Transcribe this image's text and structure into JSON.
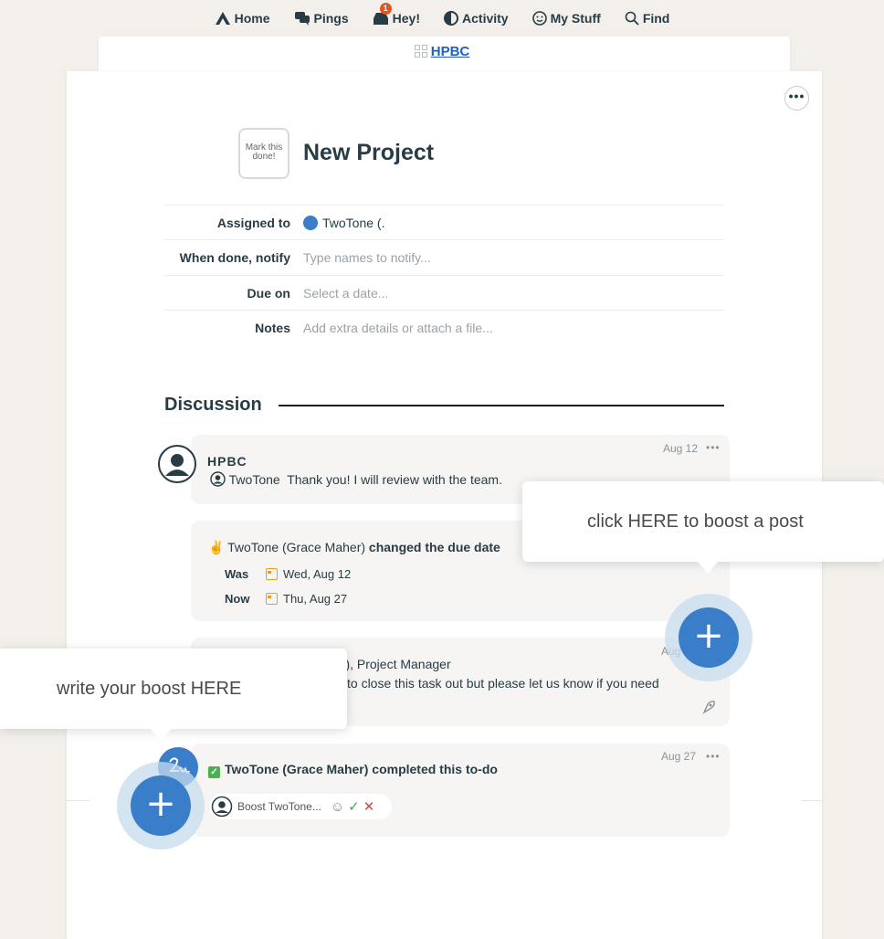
{
  "nav": {
    "home": "Home",
    "pings": "Pings",
    "hey": "Hey!",
    "hey_badge": "1",
    "activity": "Activity",
    "mystuff": "My Stuff",
    "find": "Find"
  },
  "breadcrumb": {
    "project": "HPBC"
  },
  "todo": {
    "checkbox_label": "Mark this done!",
    "title": "New Project",
    "fields": {
      "assigned_label": "Assigned to",
      "assigned_value": "TwoTone (.",
      "notify_label": "When done, notify",
      "notify_placeholder": "Type names to notify...",
      "due_label": "Due on",
      "due_placeholder": "Select a date...",
      "notes_label": "Notes",
      "notes_placeholder": "Add extra details or attach a file..."
    }
  },
  "discussion": {
    "title": "Discussion",
    "post1": {
      "author": "HPBC",
      "mention": "TwoTone",
      "text": "Thank you! I will review with the team.",
      "date": "Aug 12"
    },
    "event1": {
      "actor": "TwoTone (Grace Maher)",
      "action": "changed the due date",
      "was_label": "Was",
      "was_date": "Wed, Aug 12",
      "now_label": "Now",
      "now_date": "Thu, Aug 27"
    },
    "post2": {
      "author_fragment": "er), Project Manager",
      "text_fragment": "to close this task out but please let us know if you need",
      "date_fragment": "Aug"
    },
    "event2": {
      "actor": "TwoTone (Grace Maher)",
      "action": "completed this to-do",
      "date": "Aug 27",
      "boost_placeholder": "Boost TwoTone..."
    }
  },
  "tooltips": {
    "boost_post": "click HERE to boost a post",
    "write_boost": "write your boost HERE"
  },
  "plus_symbol": "+",
  "colors": {
    "accent": "#3a7dc9",
    "link": "#1f5fc7",
    "badge": "#e0551f"
  }
}
